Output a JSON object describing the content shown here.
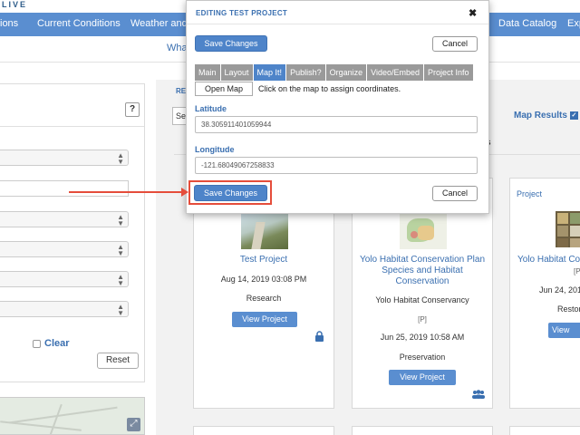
{
  "logo": {
    "text": "LIVE"
  },
  "nav": {
    "items": [
      {
        "label": "ions"
      },
      {
        "label": "Current Conditions"
      },
      {
        "label": "Weather and T"
      },
      {
        "label": "Data Catalog"
      },
      {
        "label": "Exp"
      }
    ]
  },
  "subnav": {
    "label": "What"
  },
  "sidebar": {
    "help_label": "?",
    "clear_label": "Clear",
    "reset_label": "Reset",
    "expand_icon": "expand-icon"
  },
  "content": {
    "re_label": "RE",
    "se_label": "Se",
    "map_results_label": "Map Results",
    "s_label": "s"
  },
  "cards": [
    {
      "title": "Test Project",
      "date": "Aug 14, 2019 03:08 PM",
      "category": "Research",
      "button": "View Project",
      "icon": "lock-icon"
    },
    {
      "title_line1": "Yolo Habitat Conservation Plan",
      "title_line2": "Species and Habitat",
      "title_line3": "Conservation",
      "org": "Yolo Habitat Conservancy",
      "badge": "[P]",
      "date": "Jun 25, 2019 10:58 AM",
      "category": "Preservation",
      "button": "View Project",
      "icon": "users-icon"
    },
    {
      "tag": "Project",
      "title": "Yolo Habitat Co",
      "badge": "[P",
      "date": "Jun 24, 201",
      "category": "Restor",
      "button": "View"
    }
  ],
  "modal": {
    "title": "EDITING TEST PROJECT",
    "close": "✖",
    "save_label": "Save Changes",
    "cancel_label": "Cancel",
    "tabs": [
      {
        "label": "Main",
        "active": false
      },
      {
        "label": "Layout",
        "active": false
      },
      {
        "label": "Map It!",
        "active": true
      },
      {
        "label": "Publish?",
        "active": false
      },
      {
        "label": "Organize",
        "active": false
      },
      {
        "label": "Video/Embed",
        "active": false
      },
      {
        "label": "Project Info",
        "active": false
      }
    ],
    "open_map_label": "Open Map",
    "hint": "Click on the map to assign coordinates.",
    "latitude_label": "Latitude",
    "latitude_value": "38.305911401059944",
    "longitude_label": "Longitude",
    "longitude_value": "-121.68049067258833"
  },
  "colors": {
    "accent": "#5a8ed0",
    "annotation": "#e54d3b"
  }
}
